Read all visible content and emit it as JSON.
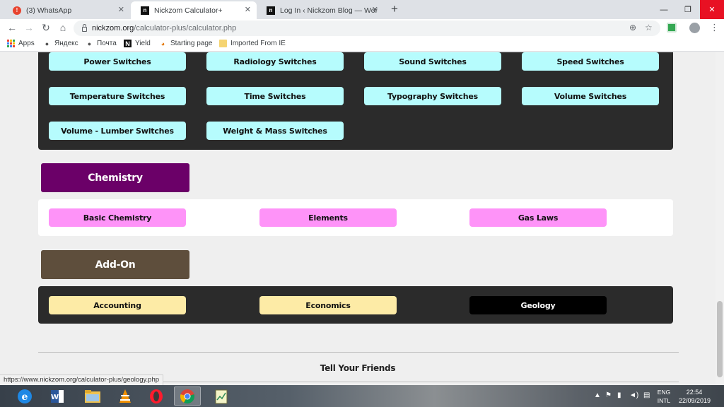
{
  "browser": {
    "tabs": [
      {
        "title": "(3) WhatsApp",
        "active": false
      },
      {
        "title": "Nickzom Calculator+",
        "active": true
      },
      {
        "title": "Log In ‹ Nickzom Blog — WordPr",
        "active": false
      }
    ],
    "url_host": "nickzom.org",
    "url_path": "/calculator-plus/calculator.php",
    "bookmarks": [
      "Apps",
      "Яндекс",
      "Почта",
      "Yield",
      "Starting page",
      "Imported From IE"
    ]
  },
  "sections": {
    "physics_rows": [
      [
        "Power Switches",
        "Radiology Switches",
        "Sound Switches",
        "Speed Switches"
      ],
      [
        "Temperature Switches",
        "Time Switches",
        "Typography Switches",
        "Volume Switches"
      ],
      [
        "Volume - Lumber Switches",
        "Weight & Mass Switches"
      ]
    ],
    "chemistry": {
      "header": "Chemistry",
      "items": [
        "Basic Chemistry",
        "Elements",
        "Gas Laws"
      ]
    },
    "addon": {
      "header": "Add-On",
      "items": [
        "Accounting",
        "Economics",
        "Geology"
      ]
    }
  },
  "footer": {
    "tell_friends": "Tell Your Friends"
  },
  "status_url": "https://www.nickzom.org/calculator-plus/geology.php",
  "taskbar": {
    "lang_top": "ENG",
    "lang_bottom": "INTL",
    "time": "22:54",
    "date": "22/09/2019"
  },
  "colors": {
    "cyan_button": "#b6fcfd",
    "pink_button": "#fe93f8",
    "yellow_button": "#fdeba6",
    "chemistry_header": "#6b0068",
    "addon_header": "#5e4e3c",
    "dark_panel": "#2b2b2b"
  },
  "icons": [
    "lock-icon",
    "zoom-icon",
    "star-icon",
    "apps-grid-icon",
    "windows-explorer-icon",
    "word-icon",
    "file-explorer-icon",
    "vlc-icon",
    "opera-icon",
    "chrome-icon",
    "notepad-icon"
  ]
}
